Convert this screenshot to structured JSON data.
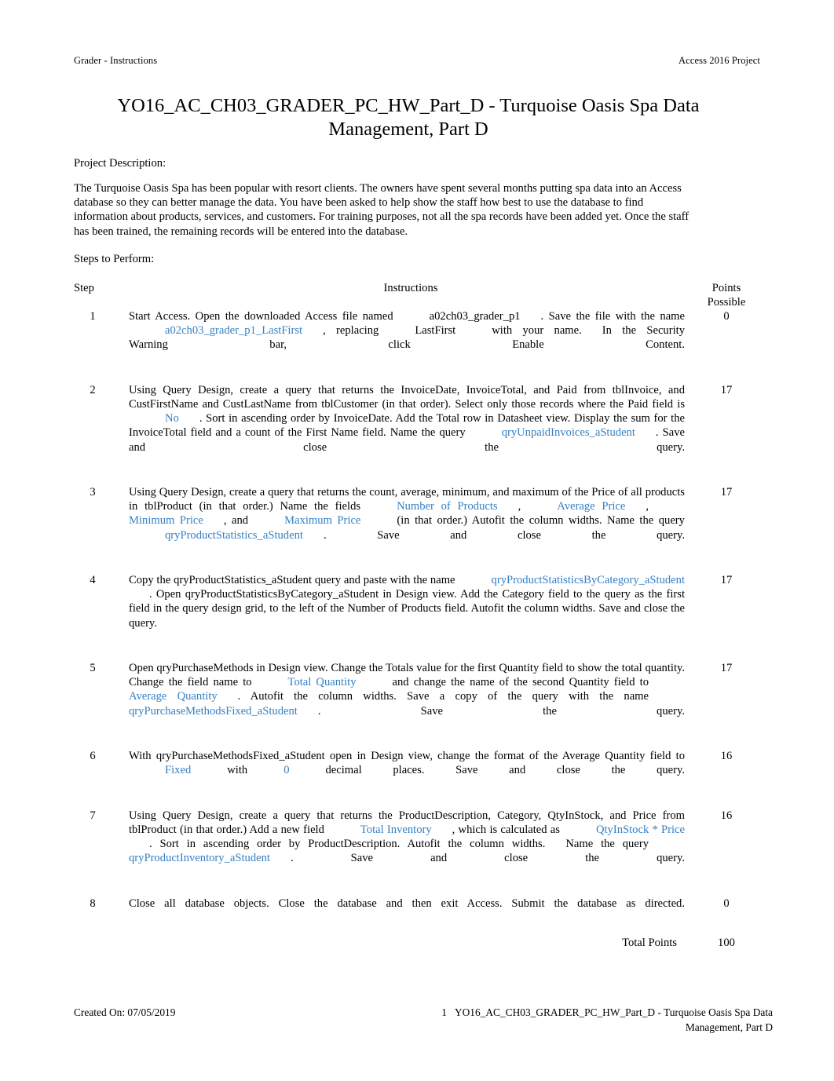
{
  "runhead": {
    "left": "Grader - Instructions",
    "right": "Access 2016 Project"
  },
  "title": "YO16_AC_CH03_GRADER_PC_HW_Part_D - Turquoise Oasis Spa Data Management, Part D",
  "project_description": {
    "label": "Project Description:",
    "body": "The Turquoise Oasis Spa has been popular with resort clients. The owners have spent several months putting spa data into an Access database so they can better manage the data. You have been asked to help show the staff how best to use the database to find information about products, services, and customers. For training purposes, not all the spa records have been added yet. Once the staff has been trained, the remaining records will be entered into the database."
  },
  "steps_label": "Steps to Perform:",
  "table": {
    "headers": {
      "step": "Step",
      "instructions": "Instructions",
      "points_line1": "Points",
      "points_line2": "Possible"
    },
    "rows": [
      {
        "step": "1",
        "points": "0",
        "parts": [
          {
            "t": "Start Access. Open the downloaded Access file named",
            "k": "text"
          },
          {
            "t": "a02ch03_grader_p1",
            "k": "plainfield"
          },
          {
            "t": ". Save the file with the name",
            "k": "text"
          },
          {
            "t": "a02ch03_grader_p1_LastFirst",
            "k": "field"
          },
          {
            "t": ", replacing",
            "k": "text"
          },
          {
            "t": "LastFirst",
            "k": "plainfield"
          },
          {
            "t": "with your name.",
            "k": "text"
          },
          {
            "t": "In the Security Warning bar, click Enable Content.",
            "k": "text"
          }
        ]
      },
      {
        "step": "2",
        "points": "17",
        "parts": [
          {
            "t": "Using Query Design, create a query that returns the InvoiceDate, InvoiceTotal, and Paid from tblInvoice, and CustFirstName and CustLastName from tblCustomer (in that order). Select only those records where the Paid field is",
            "k": "text"
          },
          {
            "t": "No",
            "k": "field"
          },
          {
            "t": ". Sort in ascending order by InvoiceDate. Add the Total row in Datasheet view. Display the sum for the InvoiceTotal field and a count of the First Name field. Name the query",
            "k": "text"
          },
          {
            "t": "qryUnpaidInvoices_aStudent",
            "k": "field"
          },
          {
            "t": ". Save and close the query.",
            "k": "text"
          }
        ]
      },
      {
        "step": "3",
        "points": "17",
        "parts": [
          {
            "t": "Using Query Design, create a query that returns the count, average, minimum, and maximum of the Price of all products in tblProduct (in that order.) Name the fields",
            "k": "text"
          },
          {
            "t": "Number of Products",
            "k": "field"
          },
          {
            "t": ",",
            "k": "text"
          },
          {
            "t": "Average Price",
            "k": "field"
          },
          {
            "t": ",",
            "k": "text"
          },
          {
            "t": "Minimum Price",
            "k": "field"
          },
          {
            "t": ", and",
            "k": "text"
          },
          {
            "t": "Maximum Price",
            "k": "field"
          },
          {
            "t": "(in that order.) Autofit the column widths. Name the query",
            "k": "text"
          },
          {
            "t": "qryProductStatistics_aStudent",
            "k": "field"
          },
          {
            "t": ". Save and close the query.",
            "k": "text"
          }
        ]
      },
      {
        "step": "4",
        "points": "17",
        "parts": [
          {
            "t": "Copy the qryProductStatistics_aStudent query and paste with the name",
            "k": "text"
          },
          {
            "t": "qryProductStatisticsByCategory_aStudent",
            "k": "field"
          },
          {
            "t": ". Open qryProductStatisticsByCategory_aStudent in Design view. Add the Category field to the query as the first field in the query design grid, to the left of the Number of Products field. Autofit the column widths. Save and close the query.",
            "k": "text"
          }
        ]
      },
      {
        "step": "5",
        "points": "17",
        "parts": [
          {
            "t": "Open qryPurchaseMethods in Design view. Change the Totals value for the first Quantity field to show the total quantity. Change the field name to",
            "k": "text"
          },
          {
            "t": "Total Quantity",
            "k": "field"
          },
          {
            "t": "and change the name of the second Quantity field to",
            "k": "text"
          },
          {
            "t": "Average Quantity",
            "k": "field"
          },
          {
            "t": ". Autofit the column widths. Save a copy of the query with the name",
            "k": "text"
          },
          {
            "t": "qryPurchaseMethodsFixed_aStudent",
            "k": "field"
          },
          {
            "t": ". Save the query.",
            "k": "text"
          }
        ]
      },
      {
        "step": "6",
        "points": "16",
        "parts": [
          {
            "t": "With qryPurchaseMethodsFixed_aStudent open in Design view, change the format of the Average Quantity field to",
            "k": "text"
          },
          {
            "t": "Fixed",
            "k": "field"
          },
          {
            "t": "with",
            "k": "text"
          },
          {
            "t": "0",
            "k": "field"
          },
          {
            "t": "decimal places. Save and close the query.",
            "k": "text"
          }
        ]
      },
      {
        "step": "7",
        "points": "16",
        "parts": [
          {
            "t": "Using Query Design, create a query that returns the ProductDescription, Category, QtyInStock, and Price from tblProduct (in that order.) Add a new field",
            "k": "text"
          },
          {
            "t": "Total Inventory",
            "k": "field"
          },
          {
            "t": ", which is calculated as",
            "k": "text"
          },
          {
            "t": "QtyInStock * Price",
            "k": "field"
          },
          {
            "t": ". Sort in ascending order by ProductDescription. Autofit the column widths.",
            "k": "text"
          },
          {
            "t": "Name the query",
            "k": "text"
          },
          {
            "t": "qryProductInventory_aStudent",
            "k": "field"
          },
          {
            "t": ". Save and close the query.",
            "k": "text"
          }
        ]
      },
      {
        "step": "8",
        "points": "0",
        "parts": [
          {
            "t": "Close all database objects. Close the database and then exit Access. Submit the database as directed.",
            "k": "text"
          }
        ]
      }
    ],
    "total_label": "Total Points",
    "total_value": "100"
  },
  "footer": {
    "created_on": "Created On: 07/05/2019",
    "page_number": "1",
    "doc_ref": "YO16_AC_CH03_GRADER_PC_HW_Part_D - Turquoise Oasis Spa Data Management, Part D"
  },
  "colors": {
    "field_blue": "#3480c4",
    "text_black": "#000000",
    "page_background": "#ffffff"
  }
}
